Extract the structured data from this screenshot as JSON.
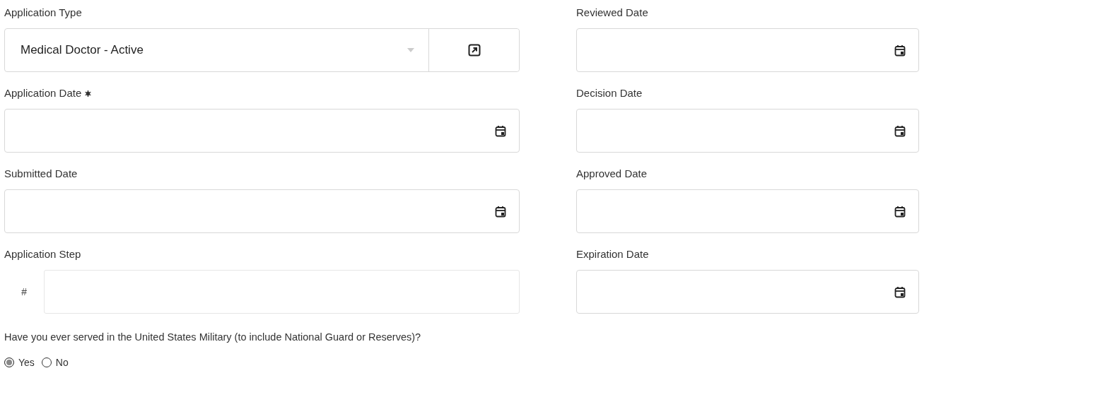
{
  "left_column": [
    {
      "kind": "select",
      "label": "Application Type",
      "value": "Medical Doctor - Active"
    },
    {
      "kind": "date",
      "label": "Application Date",
      "required": true
    },
    {
      "kind": "date",
      "label": "Submitted Date"
    },
    {
      "kind": "number",
      "label": "Application Step",
      "prefix": "#"
    }
  ],
  "question": {
    "text": "Have you ever served in the United States Military (to include National Guard or Reserves)?",
    "options": [
      {
        "label": "Yes",
        "selected": true
      },
      {
        "label": "No",
        "selected": false
      }
    ]
  },
  "right_column": [
    {
      "kind": "date",
      "label": "Reviewed Date"
    },
    {
      "kind": "date",
      "label": "Decision Date"
    },
    {
      "kind": "date",
      "label": "Approved Date"
    },
    {
      "kind": "date",
      "label": "Expiration Date"
    }
  ]
}
